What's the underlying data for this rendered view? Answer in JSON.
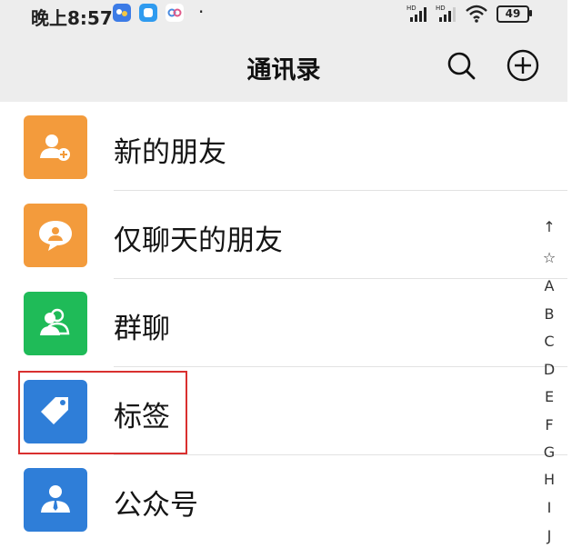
{
  "status_bar": {
    "time": "晚上8:57",
    "battery": "49",
    "icons": [
      "baidu-app-icon",
      "chat-app-icon",
      "infinity-app-icon",
      "signal-hd-icon",
      "signal-hd-icon",
      "wifi-icon",
      "battery-icon"
    ]
  },
  "header": {
    "title": "通讯录",
    "search_icon": "search-icon",
    "add_icon": "add-circle-icon"
  },
  "items": [
    {
      "label": "新的朋友",
      "icon": "add-friend-icon",
      "color": "#f39b3c"
    },
    {
      "label": "仅聊天的朋友",
      "icon": "chat-only-icon",
      "color": "#f39b3c"
    },
    {
      "label": "群聊",
      "icon": "group-chat-icon",
      "color": "#1fbb58"
    },
    {
      "label": "标签",
      "icon": "tag-icon",
      "color": "#2f7ed8"
    },
    {
      "label": "公众号",
      "icon": "official-account-icon",
      "color": "#2f7ed8"
    }
  ],
  "index_bar": [
    "↑",
    "☆",
    "A",
    "B",
    "C",
    "D",
    "E",
    "F",
    "G",
    "H",
    "I",
    "J"
  ],
  "colors": {
    "header_bg": "#ededed",
    "highlight": "#d9302f"
  }
}
